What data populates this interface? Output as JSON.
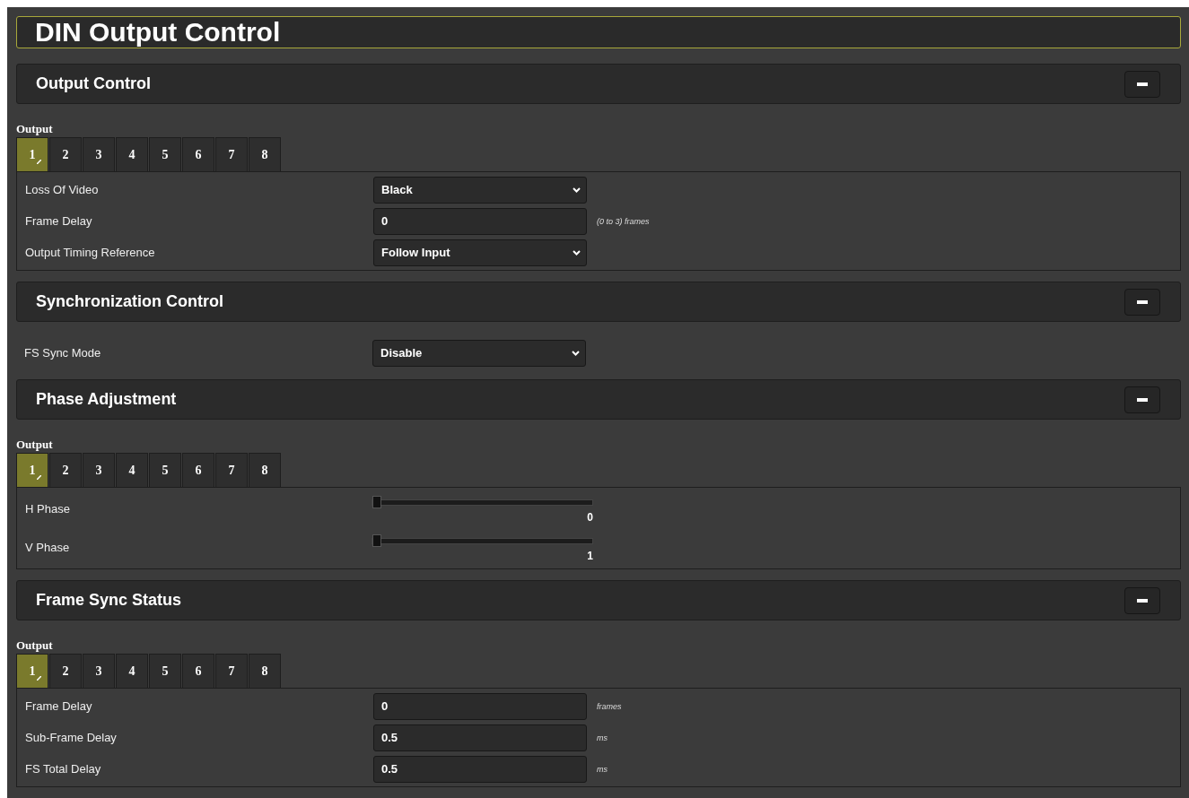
{
  "page": {
    "title": "DIN Output Control"
  },
  "sections": [
    {
      "title": "Output Control",
      "expanded": true,
      "tabs_label": "Output",
      "tabs": [
        {
          "label": "1",
          "selected": true
        },
        {
          "label": "2",
          "selected": false
        },
        {
          "label": "3",
          "selected": false
        },
        {
          "label": "4",
          "selected": false
        },
        {
          "label": "5",
          "selected": false
        },
        {
          "label": "6",
          "selected": false
        },
        {
          "label": "7",
          "selected": false
        },
        {
          "label": "8",
          "selected": false
        }
      ],
      "rows": [
        {
          "kind": "select",
          "label": "Loss Of Video",
          "value": "Black"
        },
        {
          "kind": "input",
          "label": "Frame Delay",
          "value": "0",
          "unit": "(0 to 3) frames"
        },
        {
          "kind": "select",
          "label": "Output Timing Reference",
          "value": "Follow Input"
        }
      ]
    },
    {
      "title": "Synchronization Control",
      "expanded": true,
      "rows": [
        {
          "kind": "select",
          "label": "FS Sync Mode",
          "value": "Disable"
        }
      ]
    },
    {
      "title": "Phase Adjustment",
      "expanded": true,
      "tabs_label": "Output",
      "tabs": [
        {
          "label": "1",
          "selected": true
        },
        {
          "label": "2",
          "selected": false
        },
        {
          "label": "3",
          "selected": false
        },
        {
          "label": "4",
          "selected": false
        },
        {
          "label": "5",
          "selected": false
        },
        {
          "label": "6",
          "selected": false
        },
        {
          "label": "7",
          "selected": false
        },
        {
          "label": "8",
          "selected": false
        }
      ],
      "rows": [
        {
          "kind": "slider",
          "label": "H Phase",
          "level": 0,
          "reading": "0"
        },
        {
          "kind": "slider",
          "label": "V Phase",
          "level": 0,
          "reading": "1"
        }
      ]
    },
    {
      "title": "Frame Sync Status",
      "expanded": true,
      "tabs_label": "Output",
      "tabs": [
        {
          "label": "1",
          "selected": true
        },
        {
          "label": "2",
          "selected": false
        },
        {
          "label": "3",
          "selected": false
        },
        {
          "label": "4",
          "selected": false
        },
        {
          "label": "5",
          "selected": false
        },
        {
          "label": "6",
          "selected": false
        },
        {
          "label": "7",
          "selected": false
        },
        {
          "label": "8",
          "selected": false
        }
      ],
      "rows": [
        {
          "kind": "input",
          "label": "Frame Delay",
          "value": "0",
          "unit": "frames"
        },
        {
          "kind": "input",
          "label": "Sub-Frame Delay",
          "value": "0.5",
          "unit": "ms"
        },
        {
          "kind": "input",
          "label": "FS Total Delay",
          "value": "0.5",
          "unit": "ms"
        }
      ]
    }
  ]
}
